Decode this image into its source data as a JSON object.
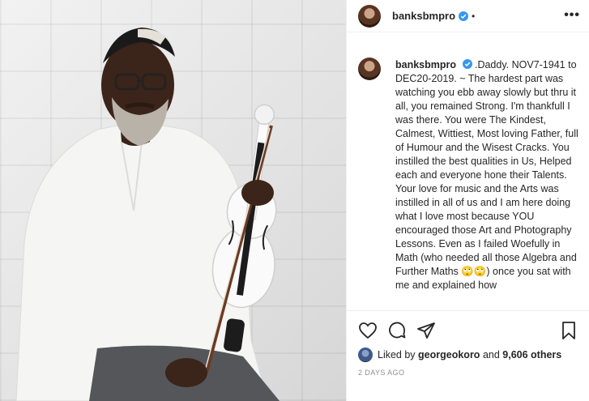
{
  "post": {
    "username": "banksbmpro",
    "header_suffix": "•",
    "caption": ".Daddy. NOV7-1941 to DEC20-2019. ~ The hardest part was watching you ebb away slowly but thru it all, you remained Strong. I'm thankfull I was there. You were The Kindest, Calmest, Wittiest, Most loving Father, full of Humour and the Wisest Cracks. You instilled the best qualities in Us, Helped each and everyone hone their Talents. Your love for music and the Arts was instilled in all of us and I am here doing what I love most because YOU encouraged those Art and Photography Lessons. Even as I failed Woefully in Math (who needed all those Algebra and Further Maths 🙄🙄) once you sat with me and explained how",
    "liked_by_prefix": "Liked by",
    "liked_by_user": "georgeokoro",
    "liked_by_and": "and",
    "likes_count": "9,606 others",
    "timestamp": "2 DAYS AGO"
  },
  "icons": {
    "more": "more-options-icon",
    "like": "heart-icon",
    "comment": "comment-icon",
    "share": "share-icon",
    "save": "bookmark-icon",
    "verified": "verified-badge-icon"
  },
  "colors": {
    "verified": "#3897f0",
    "text": "#262626",
    "muted": "#8e8e8e"
  }
}
